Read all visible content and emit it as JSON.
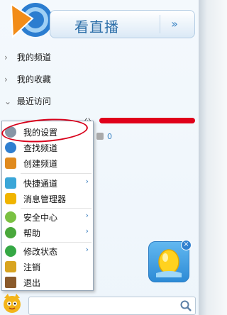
{
  "header": {
    "watch_live_label": "看直播",
    "arrow": "»"
  },
  "nav": [
    {
      "label": "我的频道",
      "chevron": "›"
    },
    {
      "label": "我的收藏",
      "chevron": "›"
    },
    {
      "label": "最近访问",
      "chevron": "⌄"
    }
  ],
  "recent": {
    "title_visible": "公",
    "count": "0"
  },
  "menu": {
    "items": [
      {
        "label": "我的设置",
        "icon": "gear-icon",
        "color": "#6b7f93",
        "submenu": false
      },
      {
        "label": "查找频道",
        "icon": "search-icon",
        "color": "#2f7fd0",
        "submenu": false
      },
      {
        "label": "创建频道",
        "icon": "home-add-icon",
        "color": "#e08a1e",
        "submenu": false
      },
      {
        "label": "快捷通道",
        "icon": "shortcut-icon",
        "color": "#3aa6d8",
        "submenu": true
      },
      {
        "label": "消息管理器",
        "icon": "message-icon",
        "color": "#f0b400",
        "submenu": false
      },
      {
        "label": "安全中心",
        "icon": "shield-icon",
        "color": "#7ac143",
        "submenu": true
      },
      {
        "label": "帮助",
        "icon": "help-icon",
        "color": "#49a83c",
        "submenu": true
      },
      {
        "label": "修改状态",
        "icon": "status-check-icon",
        "color": "#35a845",
        "submenu": true
      },
      {
        "label": "注销",
        "icon": "key-icon",
        "color": "#d8a420",
        "submenu": false
      },
      {
        "label": "退出",
        "icon": "exit-icon",
        "color": "#8a5a2b",
        "submenu": false
      }
    ],
    "submenu_arrow": "›"
  },
  "widget": {
    "close": "×"
  }
}
